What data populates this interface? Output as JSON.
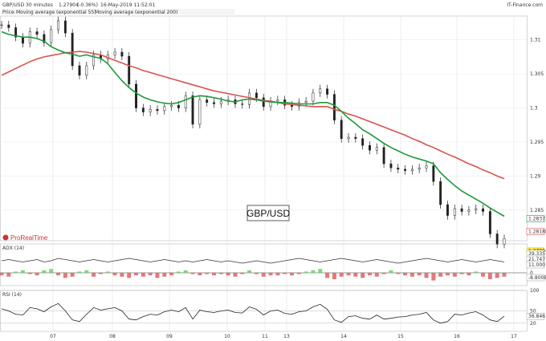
{
  "header": {
    "instrument": "GBP/USD",
    "timeframe": "30 minutes",
    "last_price": "1.27904",
    "change": "(-0.36%)",
    "datetime": "16-May-2019 11:52:01",
    "legend_price": "Price",
    "legend_ma_green": "Moving average (exponential 55)",
    "legend_ma_red": "Moving average (exponential 200)",
    "brand": "IT-Finance.com"
  },
  "watermark": {
    "pair_label": "GBP/USD",
    "logo_text": "ProRealTime"
  },
  "colors": {
    "price": "#222222",
    "ma_green": "#1a9a3a",
    "ma_red": "#d9534f",
    "adx_line": "#333333",
    "hist_pos": "#6fcf6f",
    "hist_neg": "#e06060",
    "rsi_line": "#222222",
    "last_price_box": "#ffeb3b"
  },
  "chart_data": [
    {
      "type": "line",
      "panel": "price",
      "x_tick_labels": [
        "07",
        "08",
        "09",
        "10",
        "11",
        "13",
        "14",
        "15",
        "16",
        "17"
      ],
      "y_tick_labels": [
        "1.31",
        "1.305",
        "1.3",
        "1.295",
        "1.29",
        "1.285"
      ],
      "ylim": [
        1.2805,
        1.3135
      ],
      "price_markers": [
        "1.28188",
        "1.28373",
        "1.27904"
      ],
      "series": [
        {
          "role": "price",
          "values": [
            1.3122,
            1.3118,
            1.3104,
            1.3095,
            1.3112,
            1.3108,
            1.3096,
            1.3115,
            1.3128,
            1.311,
            1.3062,
            1.3048,
            1.3062,
            1.3078,
            1.3072,
            1.3078,
            1.3082,
            1.3076,
            1.3035,
            1.3,
            1.2994,
            1.2998,
            1.2996,
            1.3002,
            1.3004,
            1.3,
            1.3018,
            1.2976,
            1.3012,
            1.3008,
            1.3006,
            1.301,
            1.3012,
            1.3006,
            1.3005,
            1.3022,
            1.3015,
            1.3002,
            1.301,
            1.3012,
            1.3004,
            1.3002,
            1.3008,
            1.301,
            1.3022,
            1.3028,
            1.302,
            1.2982,
            1.2955,
            1.2957,
            1.2955,
            1.2945,
            1.2938,
            1.2942,
            1.2918,
            1.2912,
            1.291,
            1.2908,
            1.291,
            1.2912,
            1.2915,
            1.2892,
            1.2858,
            1.2842,
            1.2852,
            1.2848,
            1.285,
            1.2852,
            1.2848,
            1.2815,
            1.28,
            1.2808
          ]
        },
        {
          "role": "ma_green",
          "values": [
            1.3112,
            1.3108,
            1.3106,
            1.3104,
            1.3104,
            1.3102,
            1.3098,
            1.309,
            1.3085,
            1.3081,
            1.3079,
            1.3076,
            1.3078,
            1.3075,
            1.3073,
            1.3065,
            1.3052,
            1.304,
            1.303,
            1.3022,
            1.3016,
            1.3012,
            1.3009,
            1.3007,
            1.3006,
            1.3008,
            1.3012,
            1.3016,
            1.3018,
            1.3017,
            1.3015,
            1.3013,
            1.301,
            1.3009,
            1.3012,
            1.3013,
            1.3012,
            1.301,
            1.3009,
            1.3008,
            1.3008,
            1.3007,
            1.3006,
            1.3006,
            1.3006,
            1.3008,
            1.3008,
            1.3004,
            1.2995,
            1.2985,
            1.2977,
            1.2968,
            1.2962,
            1.2955,
            1.2948,
            1.2942,
            1.2937,
            1.2932,
            1.2928,
            1.2925,
            1.2922,
            1.2918,
            1.2905,
            1.2895,
            1.2886,
            1.2878,
            1.2872,
            1.2866,
            1.286,
            1.2853,
            1.2847,
            1.2841
          ]
        },
        {
          "role": "ma_red",
          "values": [
            1.3048,
            1.3053,
            1.3058,
            1.3063,
            1.3068,
            1.3072,
            1.3075,
            1.3077,
            1.3079,
            1.3081,
            1.3082,
            1.3083,
            1.3082,
            1.308,
            1.3078,
            1.3074,
            1.307,
            1.3066,
            1.3062,
            1.3059,
            1.3055,
            1.3052,
            1.3049,
            1.3046,
            1.3043,
            1.304,
            1.3037,
            1.3034,
            1.3031,
            1.3028,
            1.3025,
            1.3023,
            1.3021,
            1.3019,
            1.3017,
            1.3015,
            1.3013,
            1.3011,
            1.301,
            1.3008,
            1.3006,
            1.3005,
            1.3004,
            1.3003,
            1.3002,
            1.3002,
            1.3002,
            1.2998,
            1.2995,
            1.2991,
            1.2988,
            1.2984,
            1.298,
            1.2976,
            1.2972,
            1.2968,
            1.2964,
            1.296,
            1.2955,
            1.2951,
            1.2946,
            1.2942,
            1.2937,
            1.2932,
            1.2928,
            1.2923,
            1.2918,
            1.2914,
            1.2909,
            1.2905,
            1.29,
            1.2896
          ]
        }
      ]
    },
    {
      "type": "bar",
      "panel": "adx",
      "label": "ADX (14)",
      "y_tick_labels": [
        "0"
      ],
      "value_markers": [
        "39.335",
        "21.747",
        "11.000",
        "-8.8008"
      ],
      "ylim": [
        -10,
        10
      ],
      "hist_values": [
        -2,
        -3,
        1,
        2,
        -1,
        -2,
        2,
        3,
        -2,
        -4,
        -3,
        1,
        2,
        -3,
        -1,
        1,
        -2,
        -3,
        -4,
        -2,
        -3,
        -2,
        -4,
        -3,
        -2,
        1,
        2,
        -1,
        -2,
        -1,
        -2,
        -1,
        -2,
        -3,
        -1,
        2,
        -1,
        -3,
        -2,
        -2,
        -1,
        -2,
        -1,
        1,
        2,
        3,
        -4,
        -5,
        -3,
        -2,
        -3,
        -4,
        -2,
        -3,
        -1,
        2,
        -1,
        -2,
        -3,
        -2,
        -4,
        -6,
        -3,
        -2,
        -3,
        -1,
        -2,
        1,
        -3,
        -5,
        -4,
        -3
      ],
      "adx_values": [
        6,
        7,
        6,
        5,
        6,
        7,
        5,
        6,
        8,
        7,
        6,
        5,
        6,
        7,
        6,
        5,
        6,
        7,
        8,
        7,
        6,
        5,
        6,
        7,
        6,
        5,
        6,
        5,
        6,
        7,
        6,
        5,
        6,
        5,
        4,
        5,
        6,
        5,
        4,
        5,
        6,
        7,
        8,
        7,
        6,
        5,
        6,
        7,
        8,
        7,
        6,
        5,
        6,
        7,
        6,
        5,
        4,
        5,
        6,
        7,
        8,
        7,
        6,
        5,
        6,
        7,
        6,
        5,
        6,
        7,
        6,
        5
      ]
    },
    {
      "type": "line",
      "panel": "rsi",
      "label": "RSI (14)",
      "y_tick_labels": [
        "100",
        "50",
        "20"
      ],
      "value_markers": [
        "36.846"
      ],
      "ylim": [
        0,
        100
      ],
      "series": [
        {
          "role": "rsi",
          "values": [
            55,
            50,
            42,
            40,
            58,
            55,
            48,
            60,
            68,
            50,
            28,
            24,
            42,
            58,
            52,
            55,
            58,
            50,
            30,
            28,
            36,
            42,
            40,
            48,
            52,
            48,
            58,
            30,
            52,
            48,
            46,
            50,
            52,
            46,
            45,
            60,
            54,
            40,
            50,
            52,
            44,
            42,
            48,
            50,
            60,
            66,
            54,
            28,
            22,
            36,
            38,
            32,
            30,
            40,
            30,
            32,
            35,
            36,
            40,
            42,
            46,
            28,
            20,
            24,
            42,
            40,
            45,
            48,
            40,
            28,
            24,
            37
          ]
        }
      ]
    }
  ]
}
